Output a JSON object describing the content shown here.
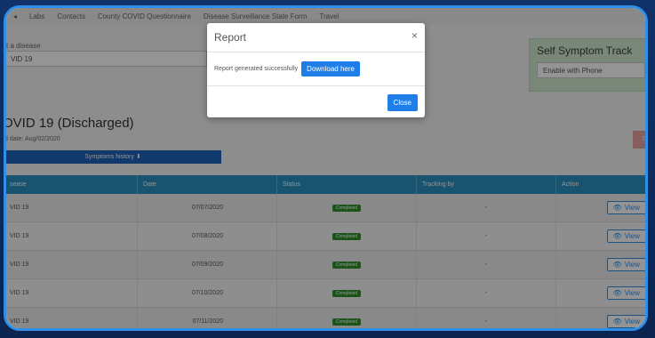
{
  "nav": {
    "items": [
      "Labs",
      "Contacts",
      "County COVID Questionnaire",
      "Disease Surveillance State Form",
      "Travel"
    ]
  },
  "disease": {
    "label": "t a disease",
    "selected": "VID 19"
  },
  "symptom_track": {
    "title": "Self Symptom Track",
    "selected": "Enable with Phone"
  },
  "main": {
    "title": "OVID 19 (Discharged)",
    "subtitle": "d date: Aug/02/2020",
    "red_button": "Ch",
    "history_button": "Symptoms history"
  },
  "table": {
    "headers": [
      "sease",
      "Date",
      "Status",
      "Tracking by",
      "Action"
    ],
    "rows": [
      {
        "disease": "VID 19",
        "date": "07/07/2020",
        "status": "Completed",
        "tracking": "-",
        "action": "View"
      },
      {
        "disease": "VID 19",
        "date": "07/08/2020",
        "status": "Completed",
        "tracking": "-",
        "action": "View"
      },
      {
        "disease": "VID 19",
        "date": "07/09/2020",
        "status": "Completed",
        "tracking": "-",
        "action": "View"
      },
      {
        "disease": "VID 19",
        "date": "07/10/2020",
        "status": "Completed",
        "tracking": "-",
        "action": "View"
      },
      {
        "disease": "VID 19",
        "date": "07/11/2020",
        "status": "Completed",
        "tracking": "-",
        "action": "View"
      }
    ]
  },
  "modal": {
    "title": "Report",
    "close_icon": "×",
    "message": "Report generated successfully",
    "download_label": "Download here",
    "close_label": "Close"
  },
  "colors": {
    "accent": "#1f7ee8",
    "frame": "#2f8fe6",
    "table_header": "#2a92bf",
    "status_completed": "#2f8f2f"
  }
}
